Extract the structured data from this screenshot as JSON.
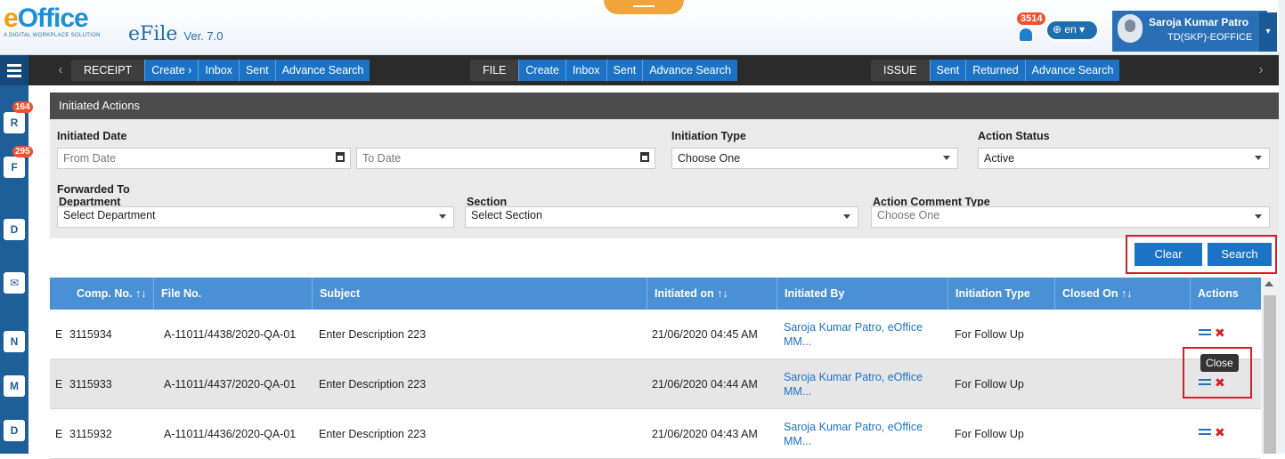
{
  "header": {
    "brand": "eOffice",
    "tagline": "A DIGITAL WORKPLACE SOLUTION",
    "app_name": "eFile",
    "version": "Ver. 7.0",
    "notification_count": "3514",
    "language": "en",
    "user_name": "Saroja Kumar Patro",
    "user_role": "TD(SKP)-EOFFICE"
  },
  "rail": {
    "receipt_badge": "164",
    "file_badge": "295"
  },
  "nav": {
    "receipt": {
      "head": "RECEIPT",
      "items": [
        "Create ›",
        "Inbox",
        "Sent",
        "Advance Search"
      ]
    },
    "file": {
      "head": "FILE",
      "items": [
        "Create",
        "Inbox",
        "Sent",
        "Advance Search"
      ]
    },
    "issue": {
      "head": "ISSUE",
      "items": [
        "Sent",
        "Returned",
        "Advance Search"
      ]
    }
  },
  "page_title": "Initiated Actions",
  "filters": {
    "initiated_date_label": "Initiated Date",
    "from_date_placeholder": "From Date",
    "to_date_placeholder": "To Date",
    "initiation_type_label": "Initiation Type",
    "initiation_type_value": "Choose One",
    "action_status_label": "Action Status",
    "action_status_value": "Active",
    "forwarded_to_label": "Forwarded To",
    "department_label": "Department",
    "department_value": "Select Department",
    "section_label": "Section",
    "section_value": "Select Section",
    "comment_type_label": "Action Comment Type",
    "comment_type_value": "Choose One"
  },
  "buttons": {
    "clear": "Clear",
    "search": "Search"
  },
  "table": {
    "columns": [
      "Comp. No. ↑↓",
      "File No.",
      "Subject",
      "Initiated on ↑↓",
      "Initiated By",
      "Initiation Type",
      "Closed On ↑↓",
      "Actions"
    ],
    "rows": [
      {
        "type": "E",
        "comp_no": "3115934",
        "file_no": "A-11011/4438/2020-QA-01",
        "subject": "Enter Description 223",
        "initiated_on": "21/06/2020 04:45 AM",
        "initiated_by": "Saroja Kumar Patro, eOffice MM...",
        "initiation_type": "For Follow Up",
        "closed_on": ""
      },
      {
        "type": "E",
        "comp_no": "3115933",
        "file_no": "A-11011/4437/2020-QA-01",
        "subject": "Enter Description 223",
        "initiated_on": "21/06/2020 04:44 AM",
        "initiated_by": "Saroja Kumar Patro, eOffice MM...",
        "initiation_type": "For Follow Up",
        "closed_on": ""
      },
      {
        "type": "E",
        "comp_no": "3115932",
        "file_no": "A-11011/4436/2020-QA-01",
        "subject": "Enter Description 223",
        "initiated_on": "21/06/2020 04:43 AM",
        "initiated_by": "Saroja Kumar Patro, eOffice MM...",
        "initiation_type": "For Follow Up",
        "closed_on": ""
      }
    ],
    "tooltip": "Close"
  },
  "colors": {
    "accent": "#1c73c6",
    "highlight": "#d4202a",
    "header_dark": "#2b2b2b"
  }
}
